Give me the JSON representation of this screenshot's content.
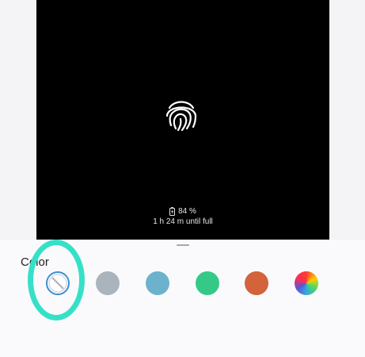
{
  "preview": {
    "battery_percent": "84 %",
    "charge_time": "1 h 24 m until full",
    "fingerprint_icon": "fingerprint-icon"
  },
  "color_sheet": {
    "label": "Color",
    "selected": "none",
    "swatches": [
      {
        "name": "none",
        "color": "#ffffff"
      },
      {
        "name": "gray",
        "color": "#a9b4bd"
      },
      {
        "name": "blue",
        "color": "#6db2cc"
      },
      {
        "name": "green",
        "color": "#35c987"
      },
      {
        "name": "orange",
        "color": "#d4623a"
      },
      {
        "name": "rainbow",
        "color": "conic"
      }
    ]
  }
}
